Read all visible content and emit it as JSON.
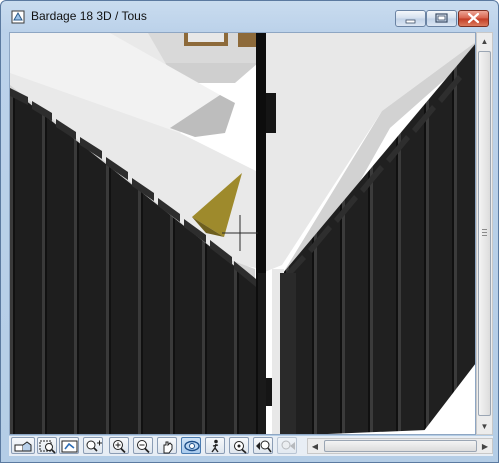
{
  "window": {
    "title": "Bardage 18 3D / Tous",
    "app_icon": "archicad-3d-window-icon",
    "controls": {
      "minimize": "minimize-icon",
      "maximize": "maximize-icon",
      "close": "close-icon"
    }
  },
  "viewport": {
    "content": "3d-model-view",
    "cursor": "crosshair"
  },
  "toolbar": {
    "tools": [
      "3d-projection-settings-icon",
      "zoom-window-icon",
      "fit-in-window-icon",
      "zoom-in-toggle-icon",
      "zoom-in-icon",
      "zoom-out-icon",
      "pan-icon",
      "orbit-icon",
      "explore-walk-icon",
      "zoom-to-selection-icon",
      "previous-zoom-icon",
      "next-zoom-icon"
    ],
    "active_tool": "orbit-icon"
  },
  "colors": {
    "title_bar": "#bcd2ea",
    "cladding_dark": "#1c1c1c",
    "roof_gray": "#e6e6e6",
    "accent_yellow": "#a08a2a",
    "active_tool": "#a9cbee"
  }
}
